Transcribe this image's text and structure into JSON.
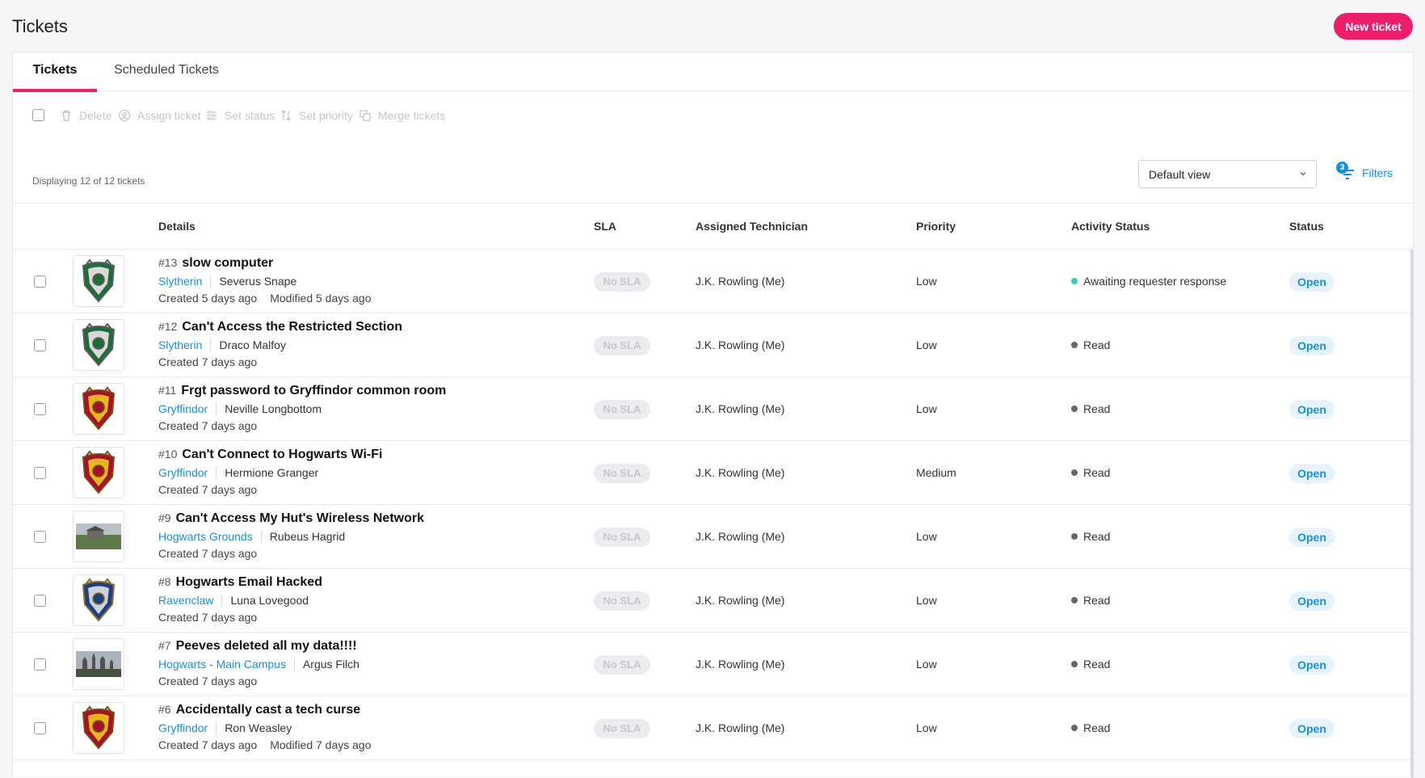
{
  "header": {
    "title": "Tickets",
    "new_ticket_label": "New ticket"
  },
  "tabs": [
    {
      "label": "Tickets",
      "active": true
    },
    {
      "label": "Scheduled Tickets",
      "active": false
    }
  ],
  "toolbar": {
    "delete_label": "Delete",
    "assign_label": "Assign ticket",
    "set_status_label": "Set status",
    "set_priority_label": "Set priority",
    "merge_label": "Merge tickets",
    "display_count": "Displaying 12 of 12 tickets",
    "view_selected": "Default view",
    "filters_label": "Filters",
    "filters_count": "3"
  },
  "columns": {
    "details": "Details",
    "sla": "SLA",
    "technician": "Assigned Technician",
    "priority": "Priority",
    "activity": "Activity Status",
    "status": "Status"
  },
  "colors": {
    "accent": "#ec1f6d",
    "link": "#1a8fd6",
    "teal": "#2ed3b0"
  },
  "tickets": [
    {
      "number": "#13",
      "subject": "slow computer",
      "site": "Slytherin",
      "requester": "Severus Snape",
      "created": "Created 5 days ago",
      "modified": "Modified 5 days ago",
      "sla": "No SLA",
      "technician": "J.K. Rowling (Me)",
      "priority": "Low",
      "activity": "Awaiting requester response",
      "activity_color": "teal",
      "status": "Open",
      "thumb": "slytherin-crest"
    },
    {
      "number": "#12",
      "subject": "Can't Access the Restricted Section",
      "site": "Slytherin",
      "requester": "Draco Malfoy",
      "created": "Created 7 days ago",
      "modified": "",
      "sla": "No SLA",
      "technician": "J.K. Rowling (Me)",
      "priority": "Low",
      "activity": "Read",
      "activity_color": "grey",
      "status": "Open",
      "thumb": "slytherin-crest"
    },
    {
      "number": "#11",
      "subject": "Frgt password to Gryffindor common room",
      "site": "Gryffindor",
      "requester": "Neville Longbottom",
      "created": "Created 7 days ago",
      "modified": "",
      "sla": "No SLA",
      "technician": "J.K. Rowling (Me)",
      "priority": "Low",
      "activity": "Read",
      "activity_color": "grey",
      "status": "Open",
      "thumb": "gryffindor-crest"
    },
    {
      "number": "#10",
      "subject": "Can't Connect to Hogwarts Wi-Fi",
      "site": "Gryffindor",
      "requester": "Hermione Granger",
      "created": "Created 7 days ago",
      "modified": "",
      "sla": "No SLA",
      "technician": "J.K. Rowling (Me)",
      "priority": "Medium",
      "activity": "Read",
      "activity_color": "grey",
      "status": "Open",
      "thumb": "gryffindor-crest"
    },
    {
      "number": "#9",
      "subject": "Can't Access My Hut's Wireless Network",
      "site": "Hogwarts Grounds",
      "requester": "Rubeus Hagrid",
      "created": "Created 7 days ago",
      "modified": "",
      "sla": "No SLA",
      "technician": "J.K. Rowling (Me)",
      "priority": "Low",
      "activity": "Read",
      "activity_color": "grey",
      "status": "Open",
      "thumb": "hut-photo"
    },
    {
      "number": "#8",
      "subject": "Hogwarts Email Hacked",
      "site": "Ravenclaw",
      "requester": "Luna Lovegood",
      "created": "Created 7 days ago",
      "modified": "",
      "sla": "No SLA",
      "technician": "J.K. Rowling (Me)",
      "priority": "Low",
      "activity": "Read",
      "activity_color": "grey",
      "status": "Open",
      "thumb": "ravenclaw-crest"
    },
    {
      "number": "#7",
      "subject": "Peeves deleted all my data!!!!",
      "site": "Hogwarts - Main Campus",
      "requester": "Argus Filch",
      "created": "Created 7 days ago",
      "modified": "",
      "sla": "No SLA",
      "technician": "J.K. Rowling (Me)",
      "priority": "Low",
      "activity": "Read",
      "activity_color": "grey",
      "status": "Open",
      "thumb": "castle-photo"
    },
    {
      "number": "#6",
      "subject": "Accidentally cast a tech curse",
      "site": "Gryffindor",
      "requester": "Ron Weasley",
      "created": "Created 7 days ago",
      "modified": "Modified 7 days ago",
      "sla": "No SLA",
      "technician": "J.K. Rowling (Me)",
      "priority": "Low",
      "activity": "Read",
      "activity_color": "grey",
      "status": "Open",
      "thumb": "gryffindor-crest"
    }
  ]
}
